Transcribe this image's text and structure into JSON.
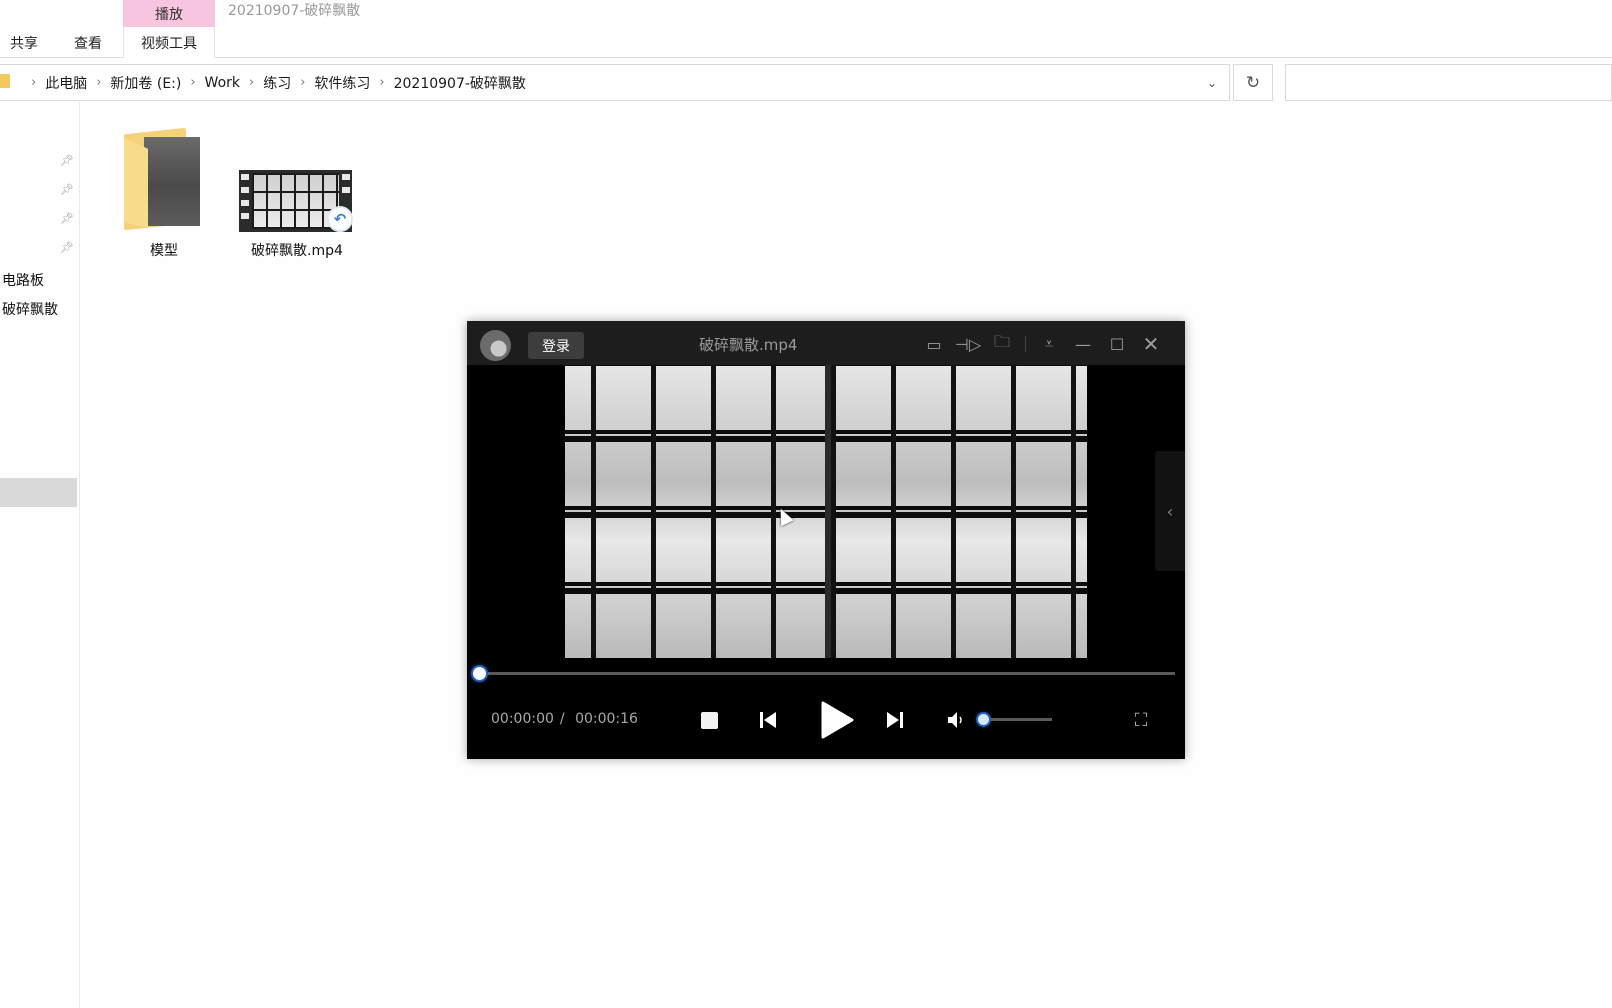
{
  "explorer": {
    "window_title": "20210907-破碎飘散",
    "ribbon": {
      "context_group_label": "播放",
      "context_tab_label": "视频工具",
      "tabs": [
        {
          "label": "共享"
        },
        {
          "label": "查看"
        }
      ],
      "context_color": "#f7c5df"
    },
    "address": {
      "breadcrumbs": [
        "此电脑",
        "新加卷 (E:)",
        "Work",
        "练习",
        "软件练习",
        "20210907-破碎飘散"
      ],
      "dropdown_icon": "chevron-down-icon",
      "refresh_icon": "refresh-icon",
      "search_placeholder": ""
    },
    "nav_pane": {
      "pinned_count": 4,
      "items": [
        {
          "label": "电路板"
        },
        {
          "label": "破碎飘散"
        }
      ]
    },
    "files": [
      {
        "name": "模型",
        "type": "folder"
      },
      {
        "name": "破碎飘散.mp4",
        "type": "video"
      }
    ]
  },
  "player": {
    "login_label": "登录",
    "title": "破碎飘散.mp4",
    "title_icons": [
      "subtitle-icon",
      "pin-icon",
      "folder-icon",
      "menu-icon",
      "minimize-icon",
      "maximize-icon",
      "close-icon"
    ],
    "current_time": "00:00:00",
    "time_separator": "/",
    "total_time": "00:00:16",
    "progress": 0,
    "volume": 0,
    "accent_color": "#3d8af7",
    "side_panel_icon": "chevron-left-icon"
  }
}
